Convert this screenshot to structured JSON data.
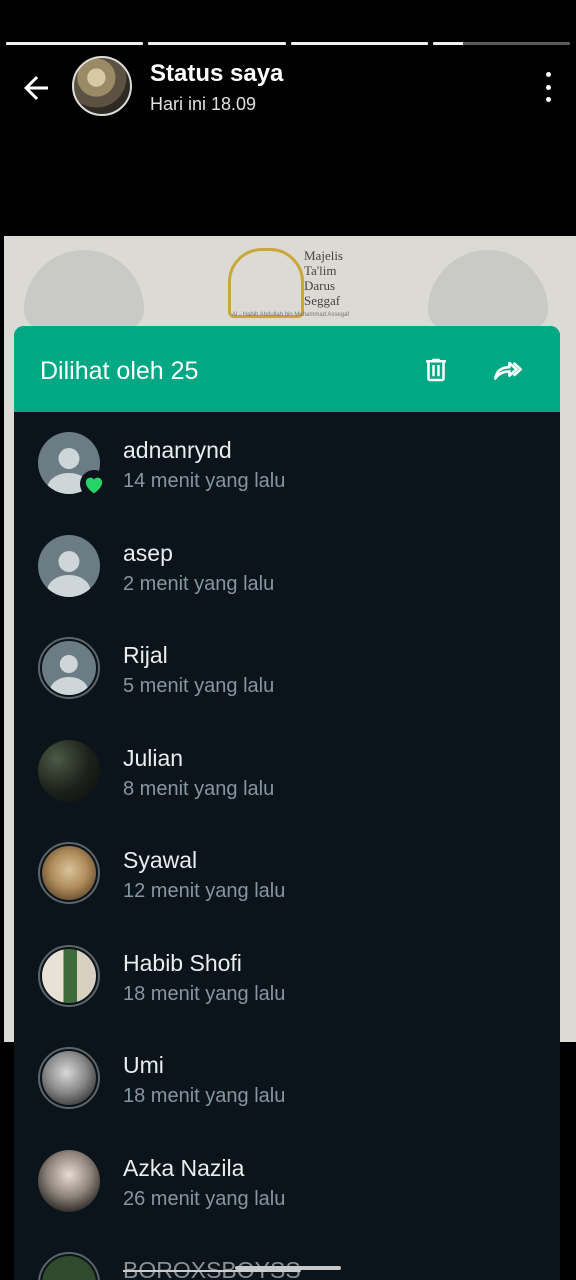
{
  "header": {
    "title": "Status saya",
    "subtitle": "Hari ini 18.09",
    "progress_segments": [
      1,
      1,
      1,
      0.2
    ]
  },
  "status_image": {
    "logo_lines": [
      "Majelis",
      "Ta'lim",
      "Darus",
      "Seggaf"
    ],
    "caption": "Al - Habib Abdullah bin Muhammad Assegaf"
  },
  "sheet": {
    "title": "Dilihat oleh 25",
    "accent_color": "#00a884",
    "delete_icon": "trash-icon",
    "forward_icon": "forward-icon"
  },
  "viewers": [
    {
      "name": "adnanrynd",
      "time": "14 menit yang lalu",
      "avatar": "default",
      "liked": true
    },
    {
      "name": "asep",
      "time": "2 menit yang lalu",
      "avatar": "default"
    },
    {
      "name": "Rijal",
      "time": "5 menit yang lalu",
      "avatar": "default-ring"
    },
    {
      "name": "Julian",
      "time": "8 menit yang lalu",
      "avatar": "photo"
    },
    {
      "name": "Syawal",
      "time": "12 menit yang lalu",
      "avatar": "photo"
    },
    {
      "name": "Habib Shofi",
      "time": "18 menit yang lalu",
      "avatar": "photo"
    },
    {
      "name": "Umi",
      "time": "18 menit yang lalu",
      "avatar": "photo"
    },
    {
      "name": "Azka Nazila",
      "time": "26 menit yang lalu",
      "avatar": "photo"
    },
    {
      "name": "BOROXSBOYSS",
      "time": "",
      "avatar": "photo"
    }
  ]
}
